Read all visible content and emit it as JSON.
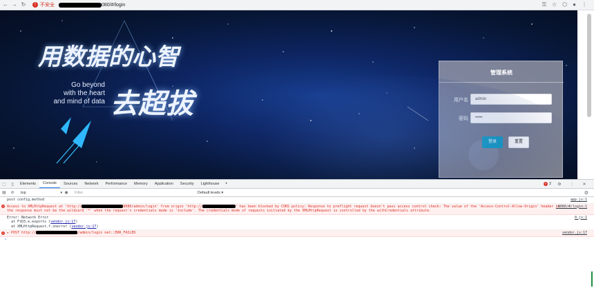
{
  "browser": {
    "security_label": "不安全",
    "url_suffix": "080/#/login"
  },
  "slogan": {
    "line1": "用数据的心智",
    "line2": "去超拔",
    "english": [
      "Go beyond",
      "with the heart",
      "and mind of data"
    ]
  },
  "login": {
    "title": "管理系统",
    "username_label": "用户名",
    "username_value": "admin",
    "password_label": "密码",
    "password_value": "•••••",
    "login_button": "登录",
    "reset_button": "重置"
  },
  "devtools": {
    "tabs": [
      "Elements",
      "Console",
      "Sources",
      "Network",
      "Performance",
      "Memory",
      "Application",
      "Security",
      "Lighthouse"
    ],
    "active_tab": "Console",
    "error_count": "2",
    "context": "top",
    "filter_placeholder": "Filter",
    "levels": "Default levels ▾",
    "messages": {
      "log1": "post config.method",
      "log1_src": "app.js:1",
      "cors_a": "Access to XMLHttpRequest at 'http://",
      "cors_b": "8080/admin/login' from origin 'http://",
      "cors_c": "' has been blocked by CORS policy: Response to preflight request doesn't pass access control check: The value of the 'Access-Control-Allow-Origin' header in",
      "cors_line2": "the response must not be the wildcard '*' when the request's credentials mode is 'include'. The credentials mode of requests initiated by the XMLHttpRequest is controlled by the withCredentials attribute.",
      "cors_src": ":8080/#/login:1",
      "neterr_1": "Error: Network Error",
      "neterr_2": "at FtD3.e.exports (",
      "neterr_2_link": "vendor.js:17",
      "neterr_3": "at XMLHttpRequest.f.onerror (",
      "neterr_3_link": "vendor.js:17",
      "neterr_src": "0.js:1",
      "post_a": "▸ POST http://",
      "post_b": "/admin/login net::ERR_FAILED",
      "post_src": "vendor.js:17",
      "prompt": "›"
    }
  }
}
